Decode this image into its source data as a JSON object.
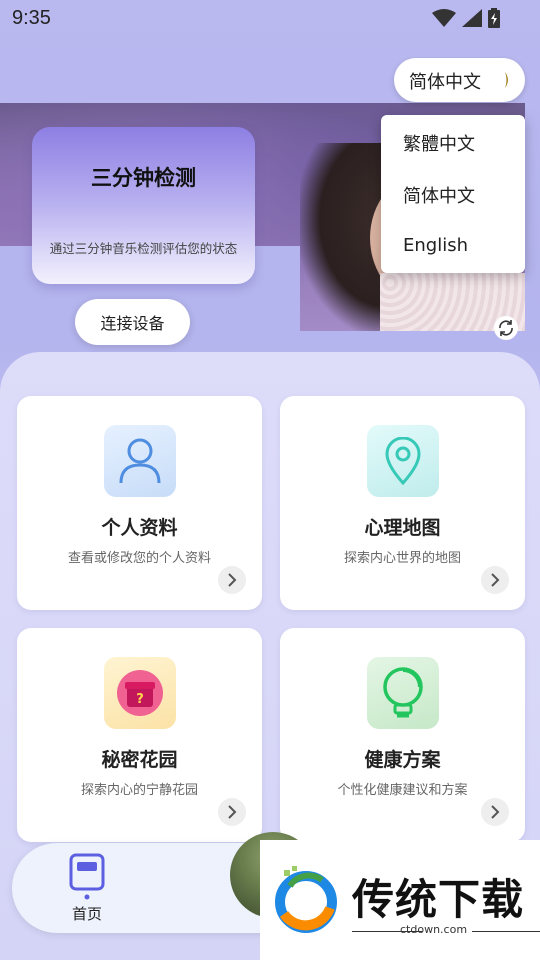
{
  "status_bar": {
    "time": "9:35"
  },
  "hero": {
    "card_title": "三分钟检测",
    "card_desc": "通过三分钟音乐检测评估您的状态",
    "connect_button": "连接设备"
  },
  "language": {
    "current": "简体中文",
    "options": [
      "繁體中文",
      "简体中文",
      "English"
    ]
  },
  "features": [
    {
      "title": "个人资料",
      "desc": "查看或修改您的个人资料",
      "icon": "user-icon",
      "tint": "#d8eafd"
    },
    {
      "title": "心理地图",
      "desc": "探索内心世界的地图",
      "icon": "map-pin-icon",
      "tint": "#d6f4f4"
    },
    {
      "title": "秘密花园",
      "desc": "探索内心的宁静花园",
      "icon": "gift-icon",
      "tint": "#fdeec4"
    },
    {
      "title": "健康方案",
      "desc": "个性化健康建议和方案",
      "icon": "lightbulb-icon",
      "tint": "#dbf1dc"
    }
  ],
  "bottom_nav": {
    "home_label": "首页"
  },
  "watermark": {
    "title": "传统下载",
    "url": "ctdown.com"
  },
  "colors": {
    "accent": "#8d7fe3",
    "nav_blue": "#5b5fe0"
  }
}
